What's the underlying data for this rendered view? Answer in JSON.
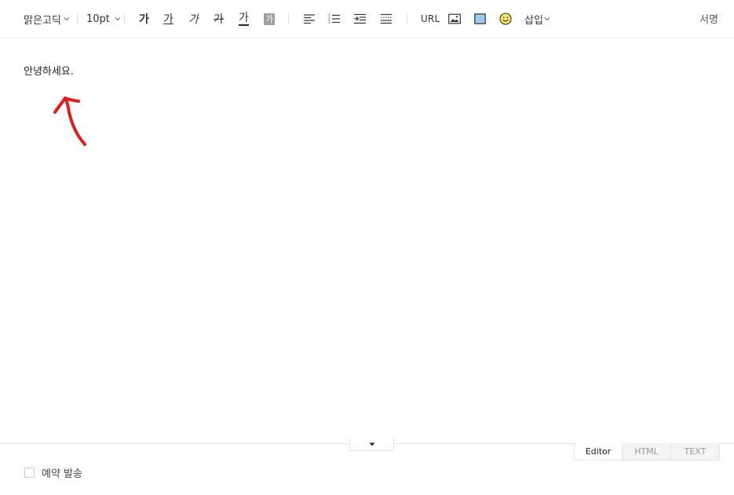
{
  "toolbar": {
    "font_family": "맑은고딕",
    "font_size": "10pt",
    "bold_label": "가",
    "underline_label": "가",
    "italic_label": "가",
    "strike_label": "가",
    "text_color_label": "가",
    "bg_color_label": "가",
    "url_label": "URL",
    "insert_label": "삽입",
    "signature_label": "서명"
  },
  "editor": {
    "content": "안녕하세요."
  },
  "annotation": {
    "arrow_color": "#e21b1b"
  },
  "view_tabs": [
    {
      "label": "Editor",
      "active": true
    },
    {
      "label": "HTML",
      "active": false
    },
    {
      "label": "TEXT",
      "active": false
    }
  ],
  "footer": {
    "scheduled_send_label": "예약 발송",
    "scheduled_send_checked": false
  }
}
